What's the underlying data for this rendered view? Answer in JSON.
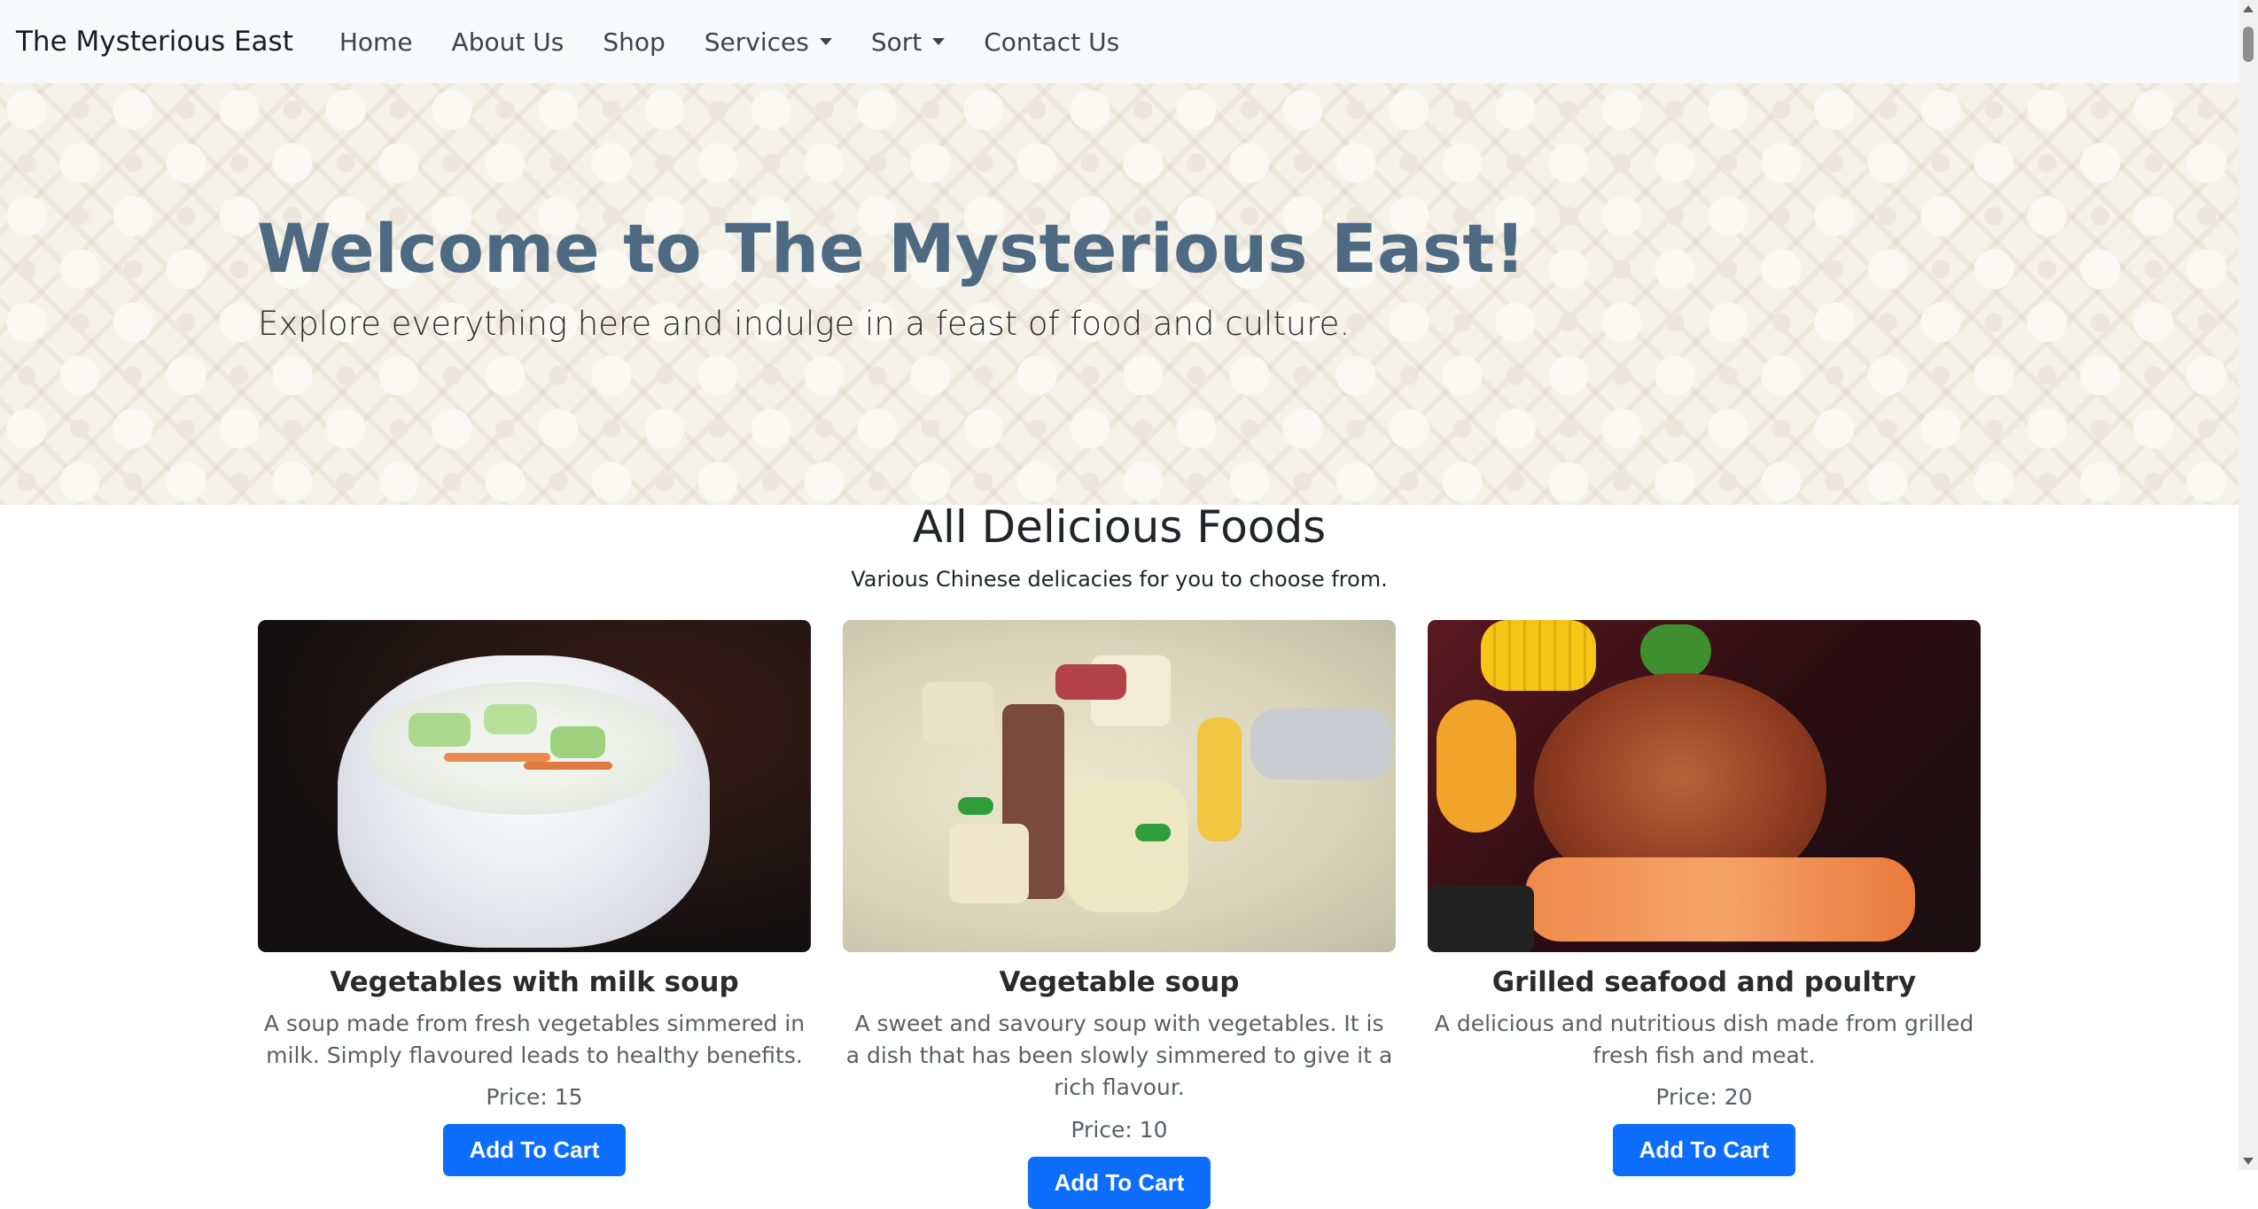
{
  "navbar": {
    "brand": "The Mysterious East",
    "links": [
      "Home",
      "About Us",
      "Shop",
      "Services",
      "Sort",
      "Contact Us"
    ]
  },
  "hero": {
    "title": "Welcome to The Mysterious East!",
    "subtitle": "Explore everything here and indulge in a feast of food and culture."
  },
  "section": {
    "title": "All Delicious Foods",
    "subtitle": "Various Chinese delicacies for you to choose from."
  },
  "products": [
    {
      "name": "Vegetables with milk soup",
      "description": "A soup made from fresh vegetables simmered in milk. Simply flavoured leads to healthy benefits.",
      "price": "Price: 15",
      "button": "Add To Cart"
    },
    {
      "name": "Vegetable soup",
      "description": "A sweet and savoury soup with vegetables. It is a dish that has been slowly simmered to give it a rich flavour.",
      "price": "Price: 10",
      "button": "Add To Cart"
    },
    {
      "name": "Grilled seafood and poultry",
      "description": "A delicious and nutritious dish made from grilled fresh fish and meat.",
      "price": "Price: 20",
      "button": "Add To Cart"
    }
  ],
  "colors": {
    "accent": "#0d6efd",
    "hero_title": "#4e6a82",
    "navbar_bg": "#f8f9fa"
  }
}
